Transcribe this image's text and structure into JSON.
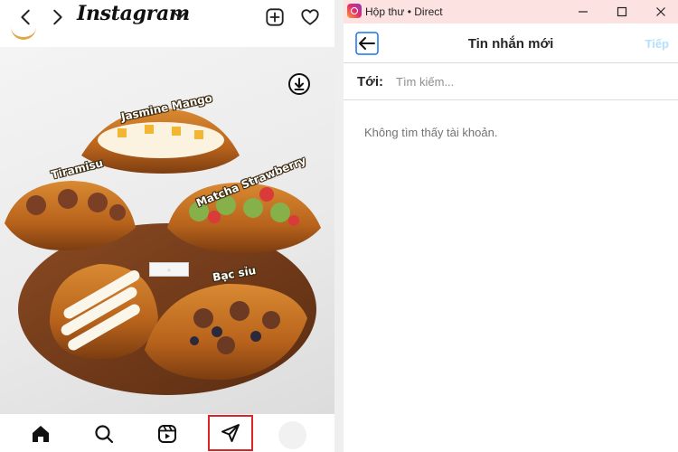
{
  "instagram": {
    "brand": "Instagram",
    "icons": {
      "back": "chevron-left-icon",
      "forward": "chevron-right-icon",
      "brand_menu": "chevron-down-icon",
      "create": "plus-square-icon",
      "activity": "heart-icon",
      "save": "download-icon"
    },
    "post": {
      "labels": [
        "Jasmine Mango",
        "Tiramisu",
        "Matcha Strawberry",
        "Bạc sỉu"
      ]
    },
    "bottom_nav": [
      "home-icon",
      "search-icon",
      "reels-icon",
      "direct-send-icon",
      "profile-avatar"
    ]
  },
  "direct": {
    "window_title": "Hộp thư • Direct",
    "header_title": "Tin nhắn mới",
    "next_label": "Tiếp",
    "to_label": "Tới:",
    "search_placeholder": "Tìm kiếm...",
    "search_value": "",
    "empty_message": "Không tìm thấy tài khoản."
  },
  "colors": {
    "titlebar_bg": "#fde2e2",
    "highlight_border": "#e02424",
    "next_disabled": "#b2dffc",
    "back_button_border": "#1a73e8"
  }
}
